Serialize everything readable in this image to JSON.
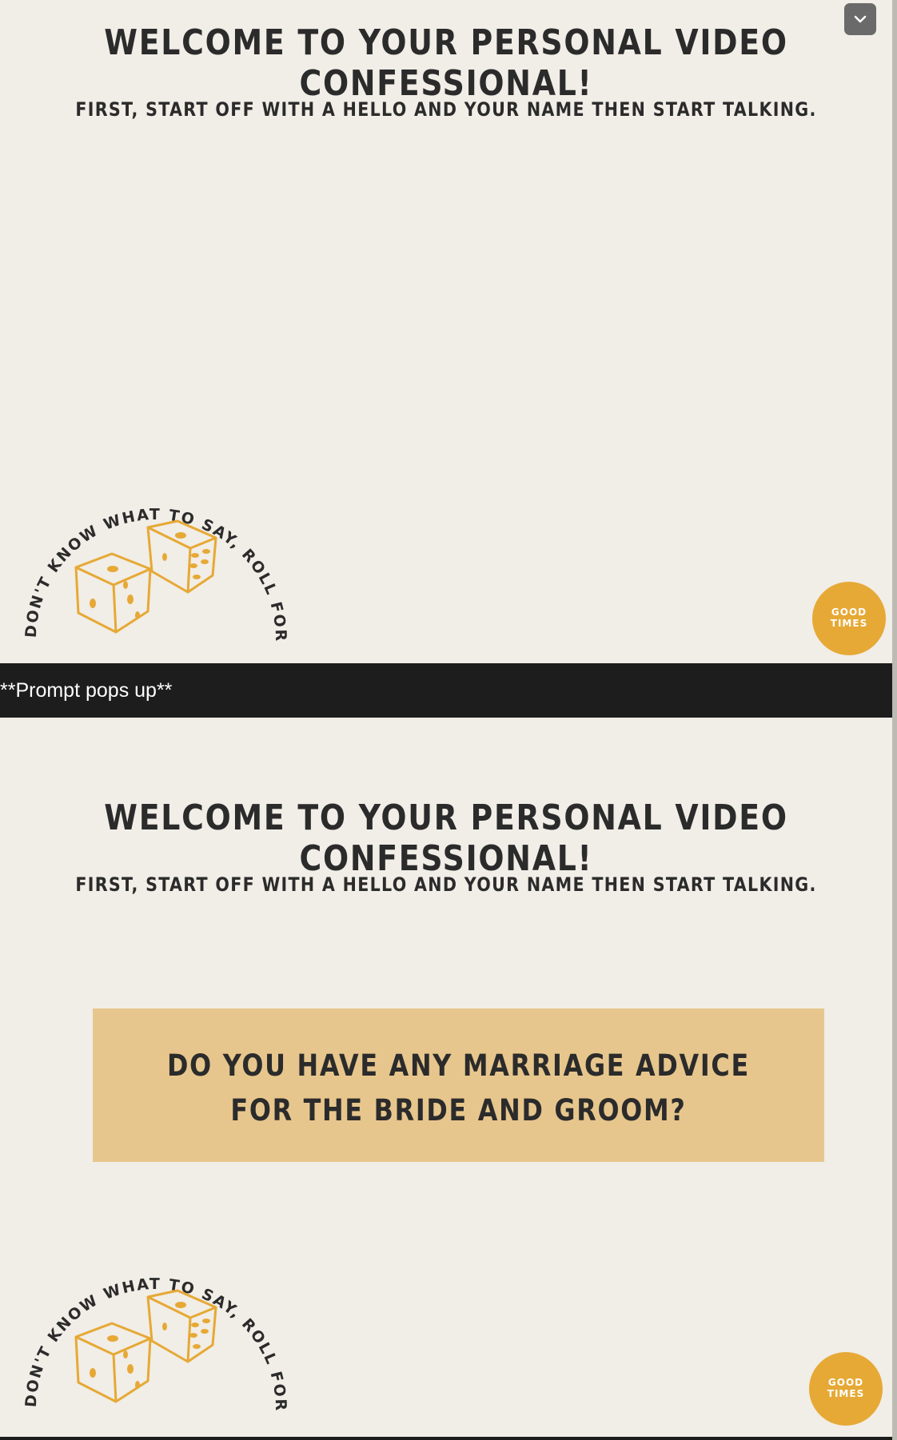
{
  "screen_before": {
    "title": "WELCOME TO YOUR PERSONAL VIDEO CONFESSIONAL!",
    "subtitle": "FIRST, START OFF WITH A HELLO AND YOUR NAME THEN START TALKING.",
    "roll_text": "AND IF YOU DON'T KNOW WHAT TO SAY, ROLL FOR A PROMPT!",
    "badge": {
      "line1": "GOOD",
      "line2": "TIMES"
    }
  },
  "caption": "**Prompt pops up**",
  "screen_after": {
    "title": "WELCOME TO YOUR PERSONAL VIDEO CONFESSIONAL!",
    "subtitle": "FIRST, START OFF WITH A HELLO AND YOUR NAME THEN START TALKING.",
    "prompt": {
      "line1": "DO YOU HAVE ANY MARRIAGE ADVICE",
      "line2": "FOR THE BRIDE AND GROOM?"
    },
    "roll_text": "AND IF YOU DON'T KNOW WHAT TO SAY, ROLL FOR A PROMPT!",
    "badge": {
      "line1": "GOOD",
      "line2": "TIMES"
    }
  },
  "colors": {
    "background": "#f1ede7",
    "text": "#2b2b2b",
    "dice": "#e6a935",
    "prompt_card": "#e7c68d",
    "badge": "#e6a935",
    "caption_bar": "#1d1d1d"
  },
  "icons": [
    "chevron-down-icon",
    "dice-icon",
    "good-times-logo"
  ]
}
